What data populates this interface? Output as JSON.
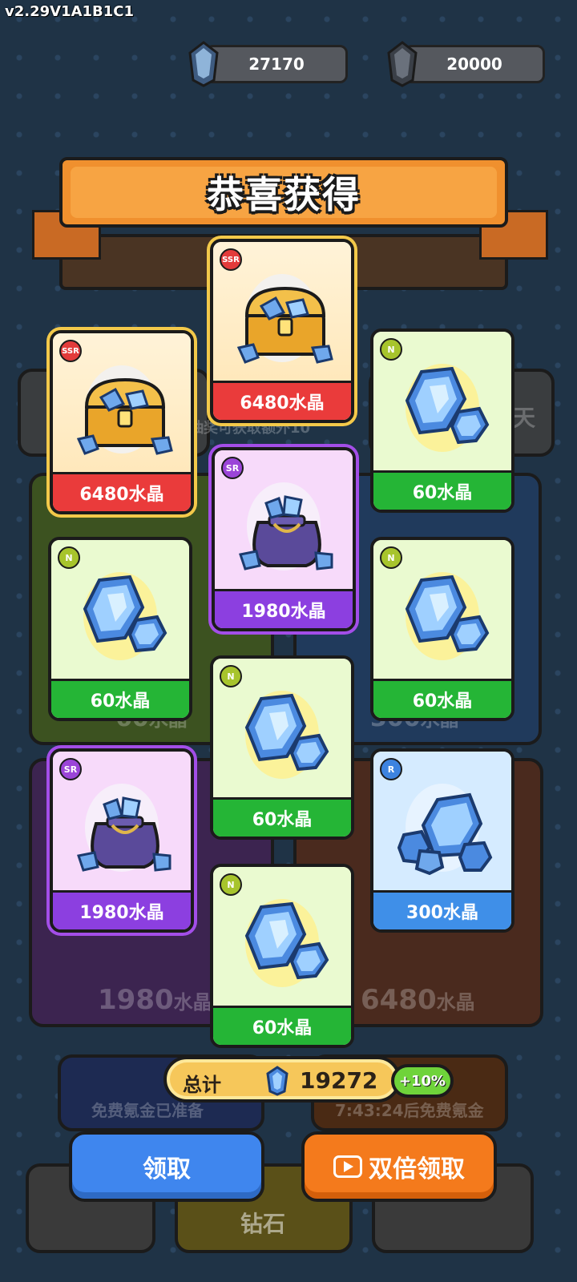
{
  "version": "v2.29V1A1B1C1",
  "currency": {
    "crystals": "27170",
    "diamonds": "20000"
  },
  "title": "恭喜获得",
  "cards": [
    {
      "rarity": "SSR",
      "amount": "6480水晶",
      "item": "treasure-chest"
    },
    {
      "rarity": "SSR",
      "amount": "6480水晶",
      "item": "treasure-chest"
    },
    {
      "rarity": "N",
      "amount": "60水晶",
      "item": "crystal-pair"
    },
    {
      "rarity": "SR",
      "amount": "1980水晶",
      "item": "crystal-bag"
    },
    {
      "rarity": "N",
      "amount": "60水晶",
      "item": "crystal-pair"
    },
    {
      "rarity": "N",
      "amount": "60水晶",
      "item": "crystal-pair"
    },
    {
      "rarity": "N",
      "amount": "60水晶",
      "item": "crystal-pair"
    },
    {
      "rarity": "SR",
      "amount": "1980水晶",
      "item": "crystal-bag"
    },
    {
      "rarity": "R",
      "amount": "300水晶",
      "item": "crystal-pile"
    },
    {
      "rarity": "N",
      "amount": "60水晶",
      "item": "crystal-pair"
    }
  ],
  "total": {
    "label": "总计",
    "value": "19272",
    "bonus": "+10%"
  },
  "buttons": {
    "claim": "领取",
    "double_claim": "双倍领取"
  },
  "background_fragments": {
    "left_price_num": "1980",
    "left_price_unit": "水晶",
    "right_price_num": "6480",
    "right_price_unit": "水晶",
    "mid_left_num": "60",
    "mid_right_num": "300",
    "mid_unit": "水晶",
    "single_free": "免费氪金已准备",
    "timer_free": "7:43:24后免费氪金",
    "draw_hint": "次抽奖可获取额外10",
    "day": "天",
    "diamond": "钻石"
  },
  "colors": {
    "ssr": "#ea3b3b",
    "sr": "#8c3fe0",
    "n": "#25b536",
    "r": "#3f8fe8",
    "claim_button": "#3f86ee",
    "double_button": "#f47a1c"
  }
}
